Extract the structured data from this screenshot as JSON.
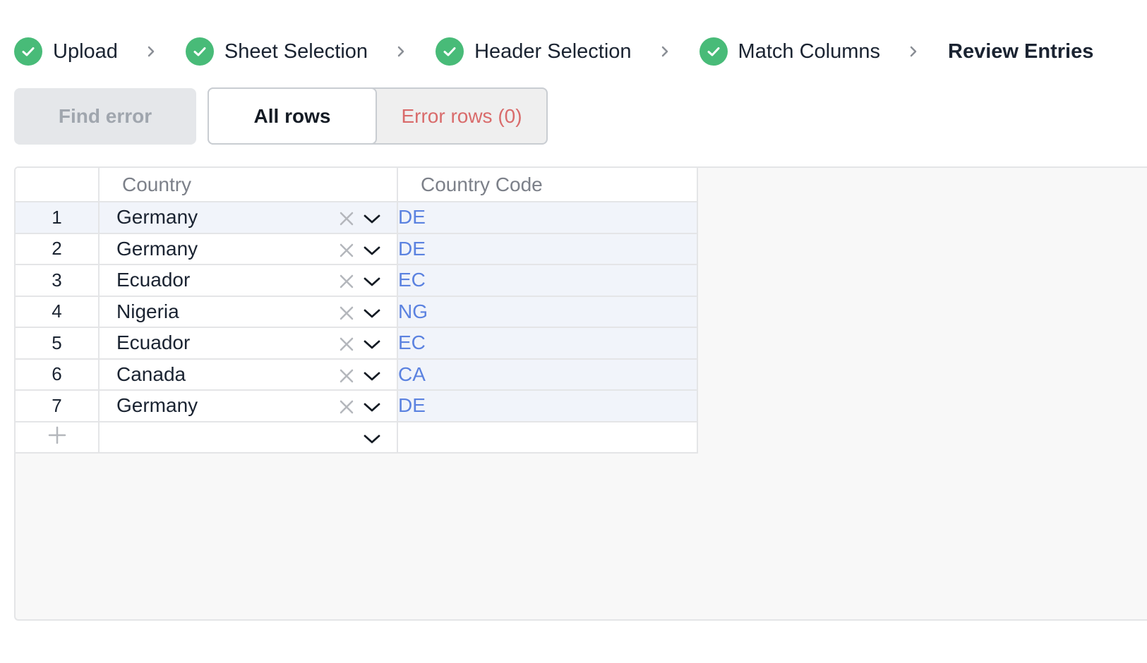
{
  "stepper": {
    "steps": [
      {
        "label": "Upload",
        "status": "complete",
        "icon": "check-circle-icon"
      },
      {
        "label": "Sheet Selection",
        "status": "complete",
        "icon": "check-circle-icon"
      },
      {
        "label": "Header Selection",
        "status": "complete",
        "icon": "check-circle-icon"
      },
      {
        "label": "Match Columns",
        "status": "complete",
        "icon": "check-circle-icon"
      },
      {
        "label": "Review Entries",
        "status": "current"
      }
    ],
    "separator_icon": "chevron-right-icon"
  },
  "toolbar": {
    "find_error_label": "Find error",
    "all_rows_label": "All rows",
    "error_rows_label": "Error rows (0)"
  },
  "grid": {
    "columns": [
      "Country",
      "Country Code"
    ],
    "rows": [
      {
        "num": "1",
        "country": "Germany",
        "code": "DE"
      },
      {
        "num": "2",
        "country": "Germany",
        "code": "DE"
      },
      {
        "num": "3",
        "country": "Ecuador",
        "code": "EC"
      },
      {
        "num": "4",
        "country": "Nigeria",
        "code": "NG"
      },
      {
        "num": "5",
        "country": "Ecuador",
        "code": "EC"
      },
      {
        "num": "6",
        "country": "Canada",
        "code": "CA"
      },
      {
        "num": "7",
        "country": "Germany",
        "code": "DE"
      }
    ],
    "add_row_icon": "plus-icon",
    "clear_icon": "close-icon",
    "dropdown_icon": "chevron-down-icon"
  },
  "colors": {
    "check": "#48bb78",
    "code_text": "#5b82e0",
    "error_text": "#d96b6b",
    "active_row": "#f1f4fa"
  }
}
